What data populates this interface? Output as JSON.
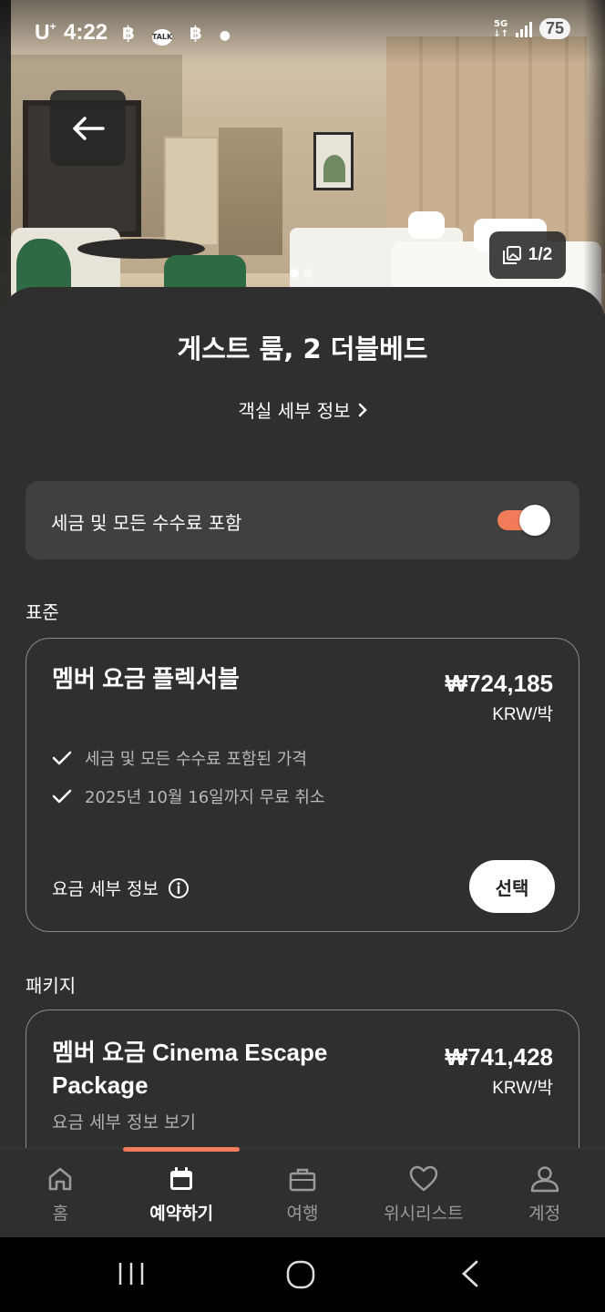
{
  "status_bar": {
    "carrier": "U",
    "carrier_sup": "+",
    "time": "4:22",
    "icons": [
      "notification-icon",
      "talk-icon",
      "notification-icon",
      "dot-icon"
    ],
    "talk_label": "TALK",
    "network_top": "5G",
    "network_bottom": "↓↑",
    "battery": "75"
  },
  "hero": {
    "gallery_count": "1/2",
    "dots": 2,
    "active_dot": 0
  },
  "room": {
    "title": "게스트 룸, 2 더블베드",
    "detail_link": "객실 세부 정보"
  },
  "tax_toggle": {
    "label": "세금 및 모든 수수료 포함",
    "on": true
  },
  "sections": {
    "standard": "표준",
    "package": "패키지"
  },
  "rates": [
    {
      "name": "멤버 요금 플렉서블",
      "price": "₩724,185",
      "unit": "KRW/박",
      "perks": [
        "세금 및 모든 수수료 포함된 가격",
        "2025년 10월 16일까지 무료 취소"
      ],
      "info_label": "요금 세부 정보",
      "select_label": "선택"
    },
    {
      "name": "멤버 요금 Cinema Escape Package",
      "price": "₩741,428",
      "unit": "KRW/박",
      "sub_link": "요금 세부 정보 보기"
    }
  ],
  "bottom_nav": [
    {
      "label": "홈",
      "icon": "home-icon",
      "active": false
    },
    {
      "label": "예약하기",
      "icon": "calendar-icon",
      "active": true
    },
    {
      "label": "여행",
      "icon": "briefcase-icon",
      "active": false
    },
    {
      "label": "위시리스트",
      "icon": "heart-icon",
      "active": false
    },
    {
      "label": "계정",
      "icon": "person-icon",
      "active": false
    }
  ],
  "colors": {
    "accent": "#f27b5a",
    "background": "#2f2f2f",
    "card_fill": "#404040"
  }
}
